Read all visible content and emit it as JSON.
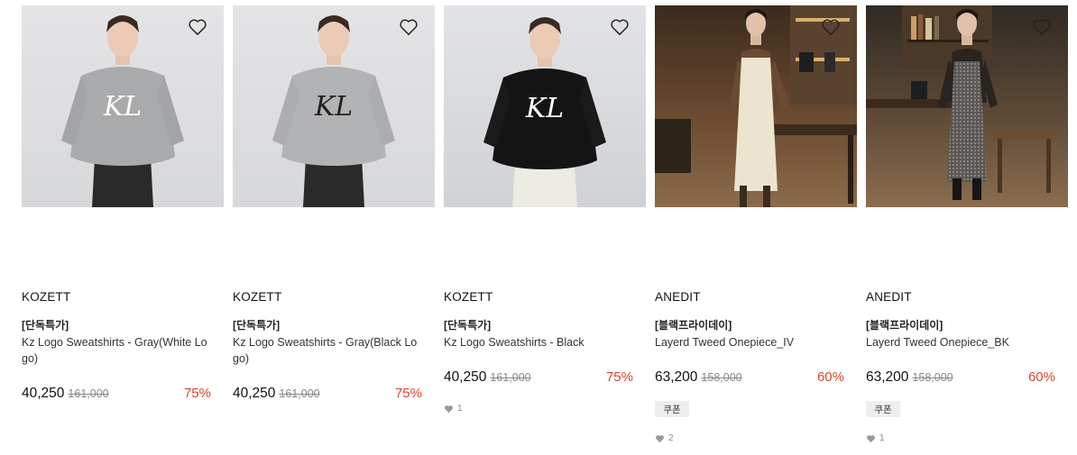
{
  "products": [
    {
      "brand": "KOZETT",
      "tag": "[단독특가]",
      "name": "Kz Logo Sweatshirts - Gray(White Logo)",
      "price": "40,250",
      "original_price": "161,000",
      "discount": "75%",
      "coupon": null,
      "likes": null
    },
    {
      "brand": "KOZETT",
      "tag": "[단독특가]",
      "name": "Kz Logo Sweatshirts - Gray(Black Logo)",
      "price": "40,250",
      "original_price": "161,000",
      "discount": "75%",
      "coupon": null,
      "likes": null
    },
    {
      "brand": "KOZETT",
      "tag": "[단독특가]",
      "name": "Kz Logo Sweatshirts - Black",
      "price": "40,250",
      "original_price": "161,000",
      "discount": "75%",
      "coupon": null,
      "likes": "1"
    },
    {
      "brand": "ANEDIT",
      "tag": "[블랙프라이데이]",
      "name": "Layerd Tweed Onepiece_IV",
      "price": "63,200",
      "original_price": "158,000",
      "discount": "60%",
      "coupon": "쿠폰",
      "likes": "2"
    },
    {
      "brand": "ANEDIT",
      "tag": "[블랙프라이데이]",
      "name": "Layerd Tweed Onepiece_BK",
      "price": "63,200",
      "original_price": "158,000",
      "discount": "60%",
      "coupon": "쿠폰",
      "likes": "1"
    }
  ],
  "photo_logo_text": "KL",
  "colors": {
    "discount": "#e0442c",
    "price": "#111111",
    "original_price": "#888888",
    "coupon_bg": "#eeeeee"
  },
  "icons": {
    "wishlist": "heart-outline-icon",
    "likes": "heart-filled-icon"
  }
}
